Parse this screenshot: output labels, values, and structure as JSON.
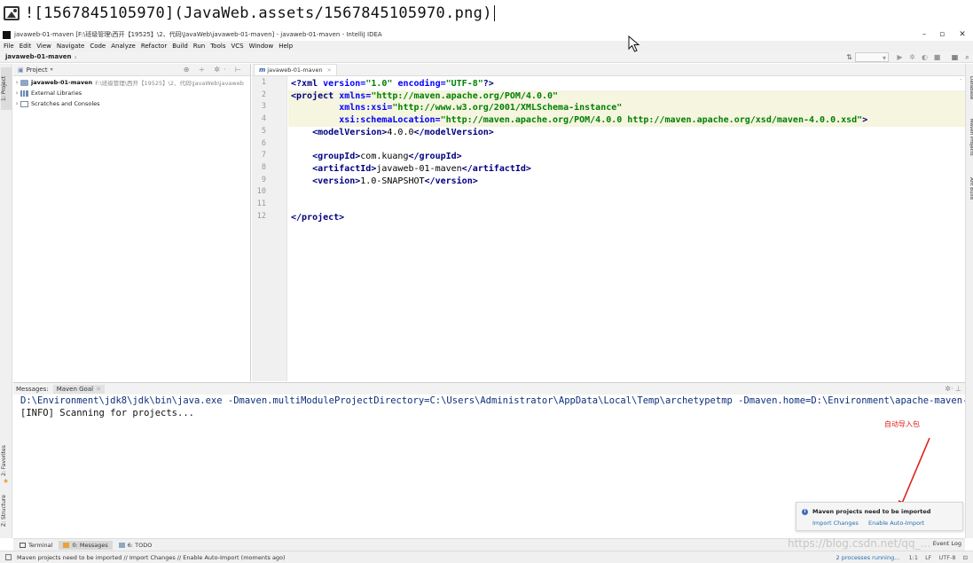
{
  "caption": {
    "text": "![1567845105970](JavaWeb.assets/1567845105970.png)"
  },
  "window": {
    "title": "javaweb-01-maven [F:\\班级管理\\西开【19525】\\2、代码\\JavaWeb\\javaweb-01-maven] - javaweb-01-maven - IntelliJ IDEA",
    "minimize": "–",
    "maximize": "▫",
    "close": "✕"
  },
  "menu": [
    "File",
    "Edit",
    "View",
    "Navigate",
    "Code",
    "Analyze",
    "Refactor",
    "Build",
    "Run",
    "Tools",
    "VCS",
    "Window",
    "Help"
  ],
  "navbar": {
    "breadcrumb": "javaweb-01-maven"
  },
  "left_strip": {
    "project_tab": "1: Project",
    "favorites_tab": "2: Favorites",
    "structure_tab": "Z: Structure"
  },
  "right_strip": {
    "database_tab": "Database",
    "maven_tab": "Maven Projects",
    "ant_tab": "Ant Build"
  },
  "project_panel": {
    "header": "Project",
    "tree": [
      {
        "label": "javaweb-01-maven",
        "path": "F:\\班级管理\\西开【19525】\\2、代码\\JavaWeb\\javaweb"
      },
      {
        "label": "External Libraries"
      },
      {
        "label": "Scratches and Consoles"
      }
    ]
  },
  "editor": {
    "tab": "javaweb-01-maven",
    "line_numbers": [
      "1",
      "2",
      "3",
      "4",
      "5",
      "6",
      "7",
      "8",
      "9",
      "10",
      "11",
      "12"
    ],
    "lines": [
      {
        "parts": [
          [
            "t",
            "<?"
          ],
          [
            "t",
            "xml "
          ],
          [
            "a",
            "version="
          ],
          [
            "v",
            "\"1.0\" "
          ],
          [
            "a",
            "encoding="
          ],
          [
            "v",
            "\"UTF-8\""
          ],
          [
            "t",
            "?>"
          ]
        ]
      },
      {
        "parts": [
          [
            "t",
            "<project "
          ],
          [
            "a",
            "xmlns="
          ],
          [
            "v",
            "\"http://maven.apache.org/POM/4.0.0\""
          ]
        ]
      },
      {
        "parts": [
          [
            "x",
            "         "
          ],
          [
            "a",
            "xmlns:xsi="
          ],
          [
            "v",
            "\"http://www.w3.org/2001/XMLSchema-instance\""
          ]
        ]
      },
      {
        "parts": [
          [
            "x",
            "         "
          ],
          [
            "a",
            "xsi:schemaLocation="
          ],
          [
            "v",
            "\"http://maven.apache.org/POM/4.0.0 http://maven.apache.org/xsd/maven-4.0.0.xsd\""
          ],
          [
            "t",
            ">"
          ]
        ]
      },
      {
        "parts": [
          [
            "x",
            "    "
          ],
          [
            "t",
            "<modelVersion>"
          ],
          [
            "x",
            "4.0.0"
          ],
          [
            "t",
            "</modelVersion>"
          ]
        ]
      },
      {
        "parts": []
      },
      {
        "parts": [
          [
            "x",
            "    "
          ],
          [
            "t",
            "<groupId>"
          ],
          [
            "x",
            "com.kuang"
          ],
          [
            "t",
            "</groupId>"
          ]
        ]
      },
      {
        "parts": [
          [
            "x",
            "    "
          ],
          [
            "t",
            "<artifactId>"
          ],
          [
            "x",
            "javaweb-01-maven"
          ],
          [
            "t",
            "</artifactId>"
          ]
        ]
      },
      {
        "parts": [
          [
            "x",
            "    "
          ],
          [
            "t",
            "<version>"
          ],
          [
            "x",
            "1.0-SNAPSHOT"
          ],
          [
            "t",
            "</version>"
          ]
        ]
      },
      {
        "parts": []
      },
      {
        "parts": []
      },
      {
        "parts": [
          [
            "t",
            "</project>"
          ]
        ]
      }
    ]
  },
  "messages": {
    "label": "Messages:",
    "tab": "Maven Goal",
    "lines": [
      "D:\\Environment\\jdk8\\jdk\\bin\\java.exe -Dmaven.multiModuleProjectDirectory=C:\\Users\\Administrator\\AppData\\Local\\Temp\\archetypetmp -Dmaven.home=D:\\Environment\\apache-maven-",
      "[INFO] Scanning for projects..."
    ]
  },
  "annotation": {
    "text": "自动导入包",
    "color": "#e0201a"
  },
  "notification": {
    "title": "Maven projects need to be imported",
    "import_changes": "Import Changes",
    "enable_auto_import": "Enable Auto-Import"
  },
  "bottom_tabs": {
    "terminal": "Terminal",
    "messages": "0: Messages",
    "todo": "6: TODO",
    "event_log": "Event Log"
  },
  "status": {
    "text": "Maven projects need to be imported // Import Changes // Enable Auto-Import (moments ago)",
    "processes": "2 processes running...",
    "position": "1:1",
    "line_sep": "LF",
    "encoding": "UTF-8"
  },
  "watermark": {
    "text": "https://blog.csdn.net/qq_..."
  }
}
